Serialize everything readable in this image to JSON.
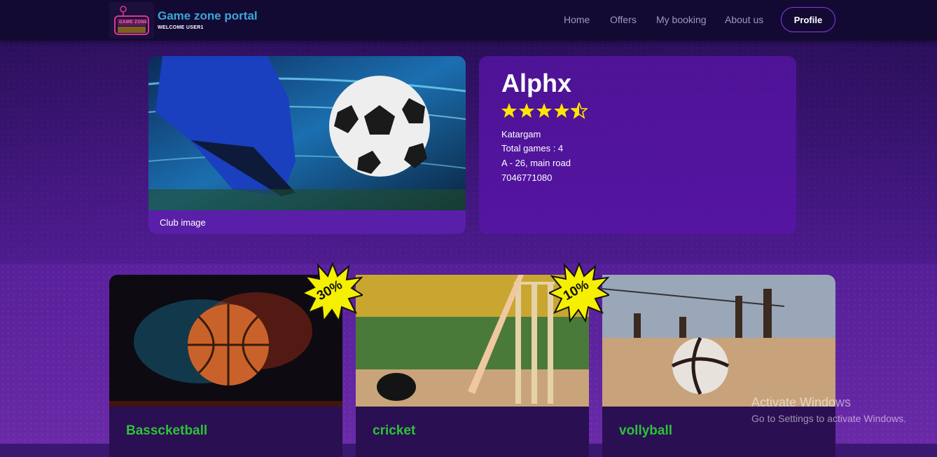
{
  "navbar": {
    "brand_title": "Game zone portal",
    "brand_subtitle": "WELCOME USER1",
    "logo_text": "GAME ZONE",
    "links": [
      "Home",
      "Offers",
      "My booking",
      "About us"
    ],
    "profile_label": "Profile"
  },
  "club": {
    "image_caption": "Club image",
    "name": "Alphx",
    "rating": 4.5,
    "rating_max": 5,
    "area": "Katargam",
    "total_games": "Total games : 4",
    "address": "A - 26, main road",
    "phone": "7046771080"
  },
  "games": [
    {
      "name": "Basscketball",
      "discount": "30%",
      "icon": "basketball-image"
    },
    {
      "name": "cricket",
      "discount": "10%",
      "icon": "cricket-image"
    },
    {
      "name": "vollyball",
      "discount": "",
      "icon": "volleyball-image"
    }
  ],
  "watermark": {
    "title": "Activate Windows",
    "subtitle": "Go to Settings to activate Windows."
  },
  "colors": {
    "brand": "#3aa7d8",
    "accent": "#8e3ce0",
    "game_title": "#2ec13a",
    "star": "#ffe600",
    "badge": "#f5ef00"
  }
}
